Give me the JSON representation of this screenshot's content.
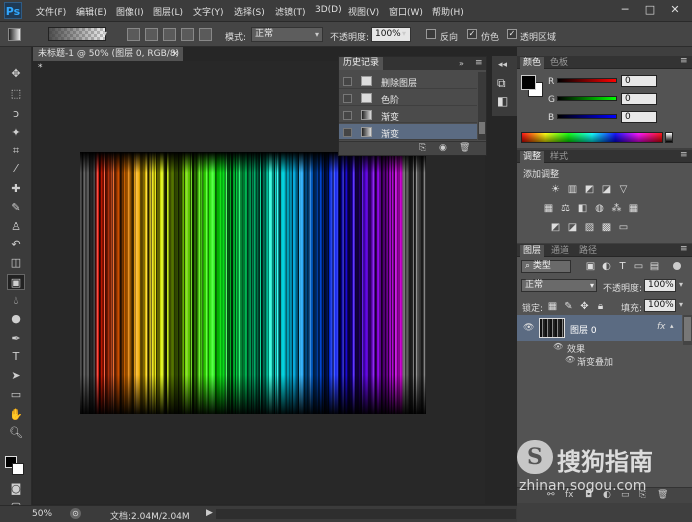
{
  "app": {
    "logo": "Ps"
  },
  "menu": [
    "文件(F)",
    "编辑(E)",
    "图像(I)",
    "图层(L)",
    "文字(Y)",
    "选择(S)",
    "滤镜(T)",
    "3D(D)",
    "视图(V)",
    "窗口(W)",
    "帮助(H)"
  ],
  "window_controls": {
    "minimize": "─",
    "restore": "□",
    "close": "✕"
  },
  "options": {
    "mode_label": "模式:",
    "mode_value": "正常",
    "opacity_label": "不透明度:",
    "opacity_value": "100%",
    "reverse_label": "反向",
    "dither_label": "仿色",
    "transparency_label": "透明区域",
    "check_mark": "✓"
  },
  "document": {
    "tab_title": "未标题-1 @ 50% (图层 0, RGB/8) *",
    "close": "×"
  },
  "status": {
    "zoom": "50%",
    "doc_size": "文档:2.04M/2.04M"
  },
  "history": {
    "title": "历史记录",
    "items": [
      {
        "label": "删除图层"
      },
      {
        "label": "色阶"
      },
      {
        "label": "渐变"
      },
      {
        "label": "渐变"
      }
    ]
  },
  "color_panel": {
    "tabs": [
      "颜色",
      "色板"
    ],
    "channels": [
      {
        "label": "R",
        "value": "0"
      },
      {
        "label": "G",
        "value": "0"
      },
      {
        "label": "B",
        "value": "0"
      }
    ]
  },
  "adjustments_panel": {
    "tabs": [
      "调整",
      "样式"
    ],
    "heading": "添加调整"
  },
  "layers_panel": {
    "tabs": [
      "图层",
      "通道",
      "路径"
    ],
    "filter_value": "类型",
    "blend_mode": "正常",
    "opacity_label": "不透明度:",
    "opacity_value": "100%",
    "lock_label": "锁定:",
    "fill_label": "填充:",
    "fill_value": "100%",
    "layer_name": "图层 0",
    "fx_label": "fx",
    "effects_label": "效果",
    "effect_item": "渐变叠加"
  },
  "watermark": {
    "brand": "搜狗指南",
    "url": "zhinan.sogou.com"
  },
  "colors": {
    "accent": "#31a8ff",
    "selected_row": "#5b6b82",
    "panel_bg": "#535353"
  }
}
